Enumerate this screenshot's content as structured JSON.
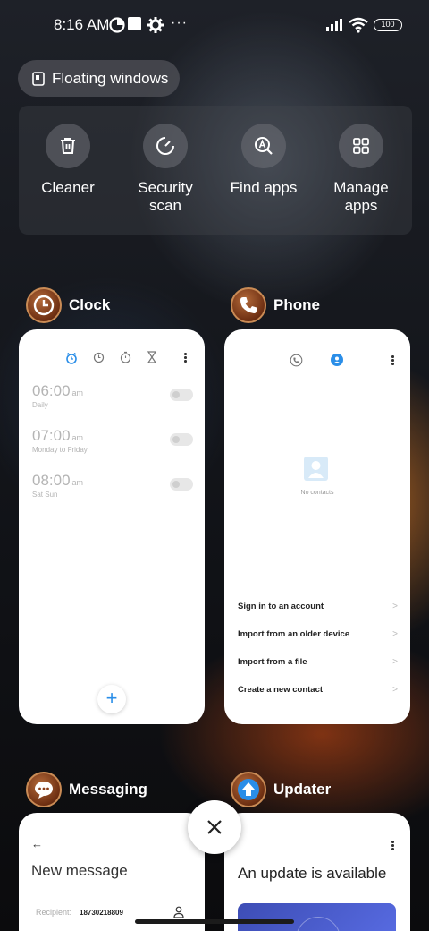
{
  "status_bar": {
    "time": "8:16 AM",
    "overflow": "···",
    "battery": "100",
    "icons": [
      "data-saver-icon",
      "square-app-icon",
      "gear-icon",
      "signal-icon",
      "wifi-icon",
      "battery-icon"
    ]
  },
  "floating_windows": {
    "label": "Floating windows",
    "icon": "floating-window-icon"
  },
  "quick_actions": [
    {
      "label": "Cleaner",
      "icon": "trash-icon"
    },
    {
      "label": "Security scan",
      "icon": "security-scan-icon"
    },
    {
      "label": "Find apps",
      "icon": "find-apps-icon"
    },
    {
      "label": "Manage apps",
      "icon": "manage-apps-icon"
    }
  ],
  "apps": {
    "clock": {
      "name": "Clock",
      "tabs": [
        "alarm-icon",
        "clock-icon",
        "stopwatch-icon",
        "timer-icon"
      ],
      "alarms": [
        {
          "time": "06:00",
          "ampm": "am",
          "sub": "Daily"
        },
        {
          "time": "07:00",
          "ampm": "am",
          "sub": "Monday to Friday"
        },
        {
          "time": "08:00",
          "ampm": "am",
          "sub": "Sat Sun"
        }
      ],
      "fab": "+"
    },
    "phone": {
      "name": "Phone",
      "empty_text": "No contacts",
      "actions": [
        "Sign in to an account",
        "Import from an older device",
        "Import from a file",
        "Create a new contact"
      ],
      "arrow": ">"
    },
    "messaging": {
      "name": "Messaging",
      "back": "←",
      "title": "New message",
      "recipient_label": "Recipient:",
      "recipient_value": "18730218809"
    },
    "updater": {
      "name": "Updater",
      "title": "An update is available"
    }
  },
  "colors": {
    "accent": "#2a8ee8",
    "card_bg": "#ffffff",
    "panel": "#46484e"
  }
}
